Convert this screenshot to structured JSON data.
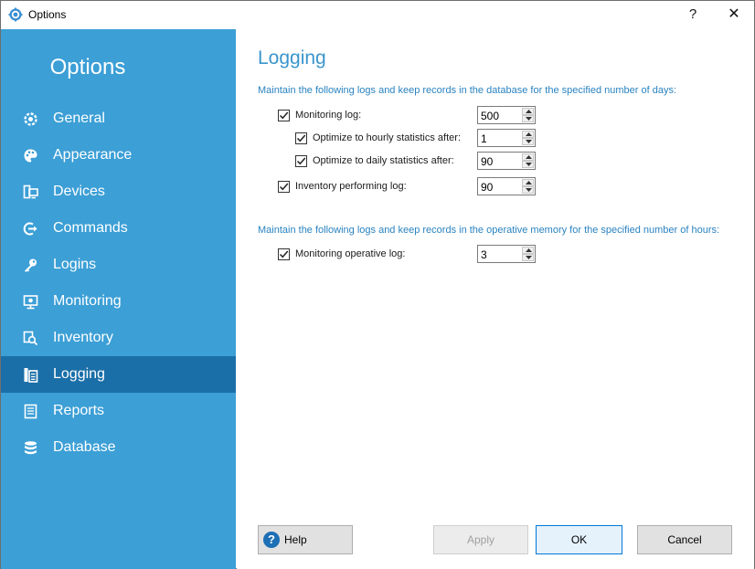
{
  "window": {
    "title": "Options",
    "help_glyph": "?",
    "close_glyph": "✕"
  },
  "sidebar": {
    "title": "Options",
    "items": [
      {
        "label": "General",
        "icon": "gear-icon",
        "active": false
      },
      {
        "label": "Appearance",
        "icon": "palette-icon",
        "active": false
      },
      {
        "label": "Devices",
        "icon": "devices-icon",
        "active": false
      },
      {
        "label": "Commands",
        "icon": "command-arrow-icon",
        "active": false
      },
      {
        "label": "Logins",
        "icon": "key-icon",
        "active": false
      },
      {
        "label": "Monitoring",
        "icon": "monitor-icon",
        "active": false
      },
      {
        "label": "Inventory",
        "icon": "inventory-search-icon",
        "active": false
      },
      {
        "label": "Logging",
        "icon": "log-book-icon",
        "active": true
      },
      {
        "label": "Reports",
        "icon": "report-icon",
        "active": false
      },
      {
        "label": "Database",
        "icon": "database-icon",
        "active": false
      }
    ]
  },
  "main": {
    "heading": "Logging",
    "database_section": {
      "description": "Maintain the following logs and keep records in the database for the specified number of days:",
      "options": [
        {
          "label": "Monitoring log:",
          "checked": true,
          "value": "500"
        },
        {
          "label": "Optimize to hourly statistics after:",
          "checked": true,
          "value": "1"
        },
        {
          "label": "Optimize to daily statistics after:",
          "checked": true,
          "value": "90"
        },
        {
          "label": "Inventory performing log:",
          "checked": true,
          "value": "90"
        }
      ]
    },
    "memory_section": {
      "description": "Maintain the following logs and keep records in the operative memory for the specified number of hours:",
      "options": [
        {
          "label": "Monitoring operative log:",
          "checked": true,
          "value": "3"
        }
      ]
    }
  },
  "footer": {
    "help_label": "Help",
    "help_icon_glyph": "?",
    "apply_label": "Apply",
    "ok_label": "OK",
    "cancel_label": "Cancel"
  },
  "colors": {
    "sidebar_bg": "#3c9fd6",
    "sidebar_active_bg": "#1b6fa8",
    "heading": "#3a95cc",
    "description": "#2a83c0"
  }
}
